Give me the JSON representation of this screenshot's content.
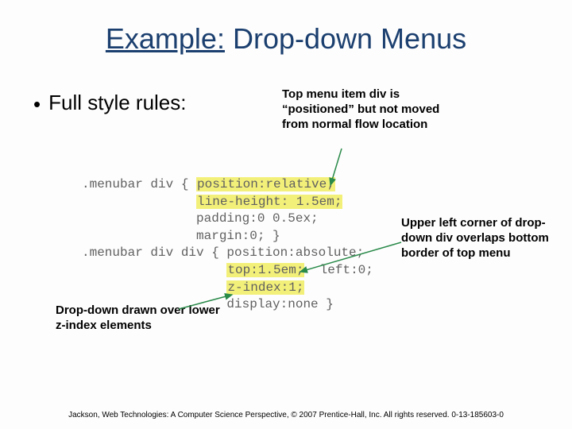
{
  "title": {
    "underlined": "Example:",
    "rest": " Drop-down Menus"
  },
  "bullet": "Full style rules:",
  "notes": {
    "top": "Top menu item div is “positioned” but not moved from normal flow location",
    "right": "Upper left corner of drop-down div overlaps bottom border of top menu",
    "left": "Drop-down drawn over lower z-index elements"
  },
  "code": {
    "l1a": ".menubar div { ",
    "l1b": "position:relative;",
    "l2a": "               ",
    "l2b": "line-height: 1.5em;",
    "l3": "               padding:0 0.5ex;",
    "l4": "               margin:0; }",
    "l5": ".menubar div div { position:absolute;",
    "l6a": "                   ",
    "l6b": "top:1.5em;",
    "l6c": "  left:0;",
    "l7a": "                   ",
    "l7b": "z-index:1;",
    "l8": "                   display:none }"
  },
  "footer": "Jackson, Web Technologies: A Computer Science Perspective, © 2007 Prentice-Hall, Inc. All rights reserved. 0-13-185603-0"
}
